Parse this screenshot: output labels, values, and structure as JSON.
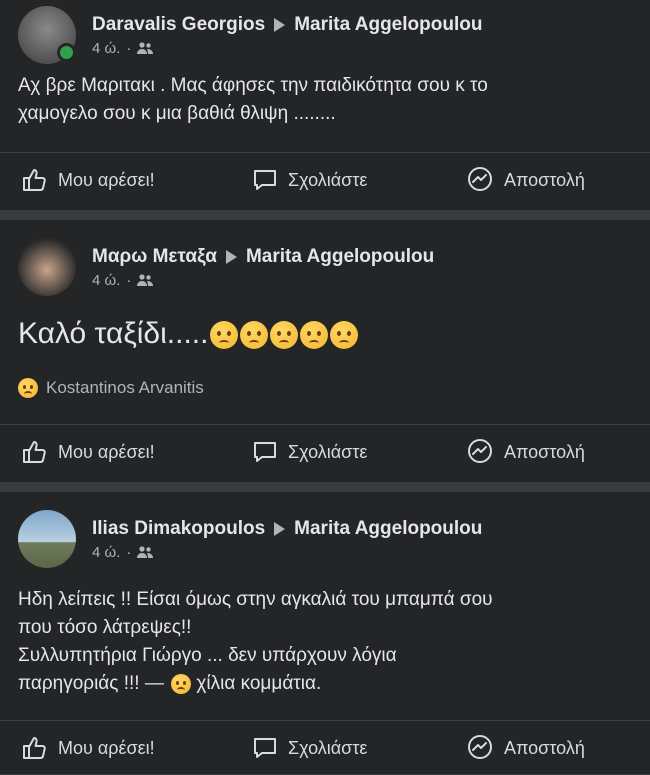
{
  "posts": [
    {
      "author": "Daravalis Georgios",
      "target": "Marita Aggelopoulou",
      "time": "4 ώ.",
      "dot": "·",
      "text_lines": [
        "Αχ βρε Μαριτακι . Μας άφησες την παιδικότητα σου κ το",
        "χαμογελο σου κ μια βαθιά θλιψη ........"
      ],
      "online": true
    },
    {
      "author": "Μαρω Μεταξα",
      "target": "Marita Aggelopoulou",
      "time": "4 ώ.",
      "dot": "·",
      "big_text": "Καλό ταξίδι.....",
      "emoji_count": 5,
      "reaction_name": "Kostantinos Arvanitis"
    },
    {
      "author": "Ilias Dimakopoulos",
      "target": "Marita Aggelopoulou",
      "time": "4 ώ.",
      "dot": "·",
      "text_lines": [
        "Ηδη λείπεις !!  Είσαι όμως στην αγκαλιά του μπαμπά σου",
        "που τόσο λάτρεψες!!",
        "Συλλυπητήρια Γιώργο ... δεν υπάρχουν λόγια",
        "παρηγοριάς !!! —"
      ],
      "text_tail": "χίλια κομμάτια."
    }
  ],
  "actions": {
    "like": "Μου αρέσει!",
    "comment": "Σχολιάστε",
    "send": "Αποστολή"
  },
  "icons": [
    "like-icon",
    "comment-icon",
    "messenger-icon",
    "friends-icon",
    "sad-emoji-icon"
  ],
  "colors": {
    "card": "#242526",
    "separator": "#3a3b3c",
    "text": "#e4e6eb",
    "secondary": "#b0b3b8",
    "online": "#31a24c"
  }
}
